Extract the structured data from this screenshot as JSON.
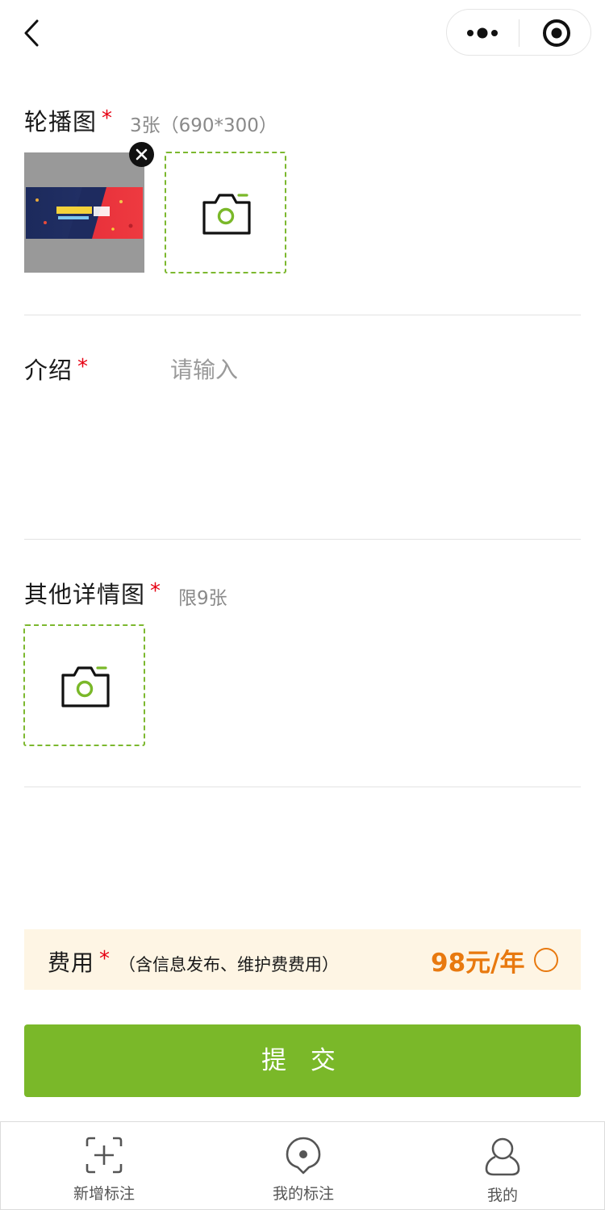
{
  "carousel": {
    "label": "轮播图",
    "required": "*",
    "hint": "3张（690*300）"
  },
  "intro": {
    "label": "介绍",
    "required": "*",
    "placeholder": "请输入"
  },
  "details": {
    "label": "其他详情图",
    "required": "*",
    "hint": "限9张"
  },
  "fee": {
    "label": "费用",
    "required": "*",
    "note": "（含信息发布、维护费费用）",
    "price": "98元/年"
  },
  "submit_label": "提 交",
  "tabbar": {
    "items": [
      {
        "label": "新增标注",
        "icon": "add-scan-icon"
      },
      {
        "label": "我的标注",
        "icon": "location-pin-icon"
      },
      {
        "label": "我的",
        "icon": "user-icon"
      }
    ]
  },
  "colors": {
    "accent": "#7ab829",
    "price": "#e8790f",
    "required": "#e60012",
    "fee_bg": "#fef5e4"
  }
}
